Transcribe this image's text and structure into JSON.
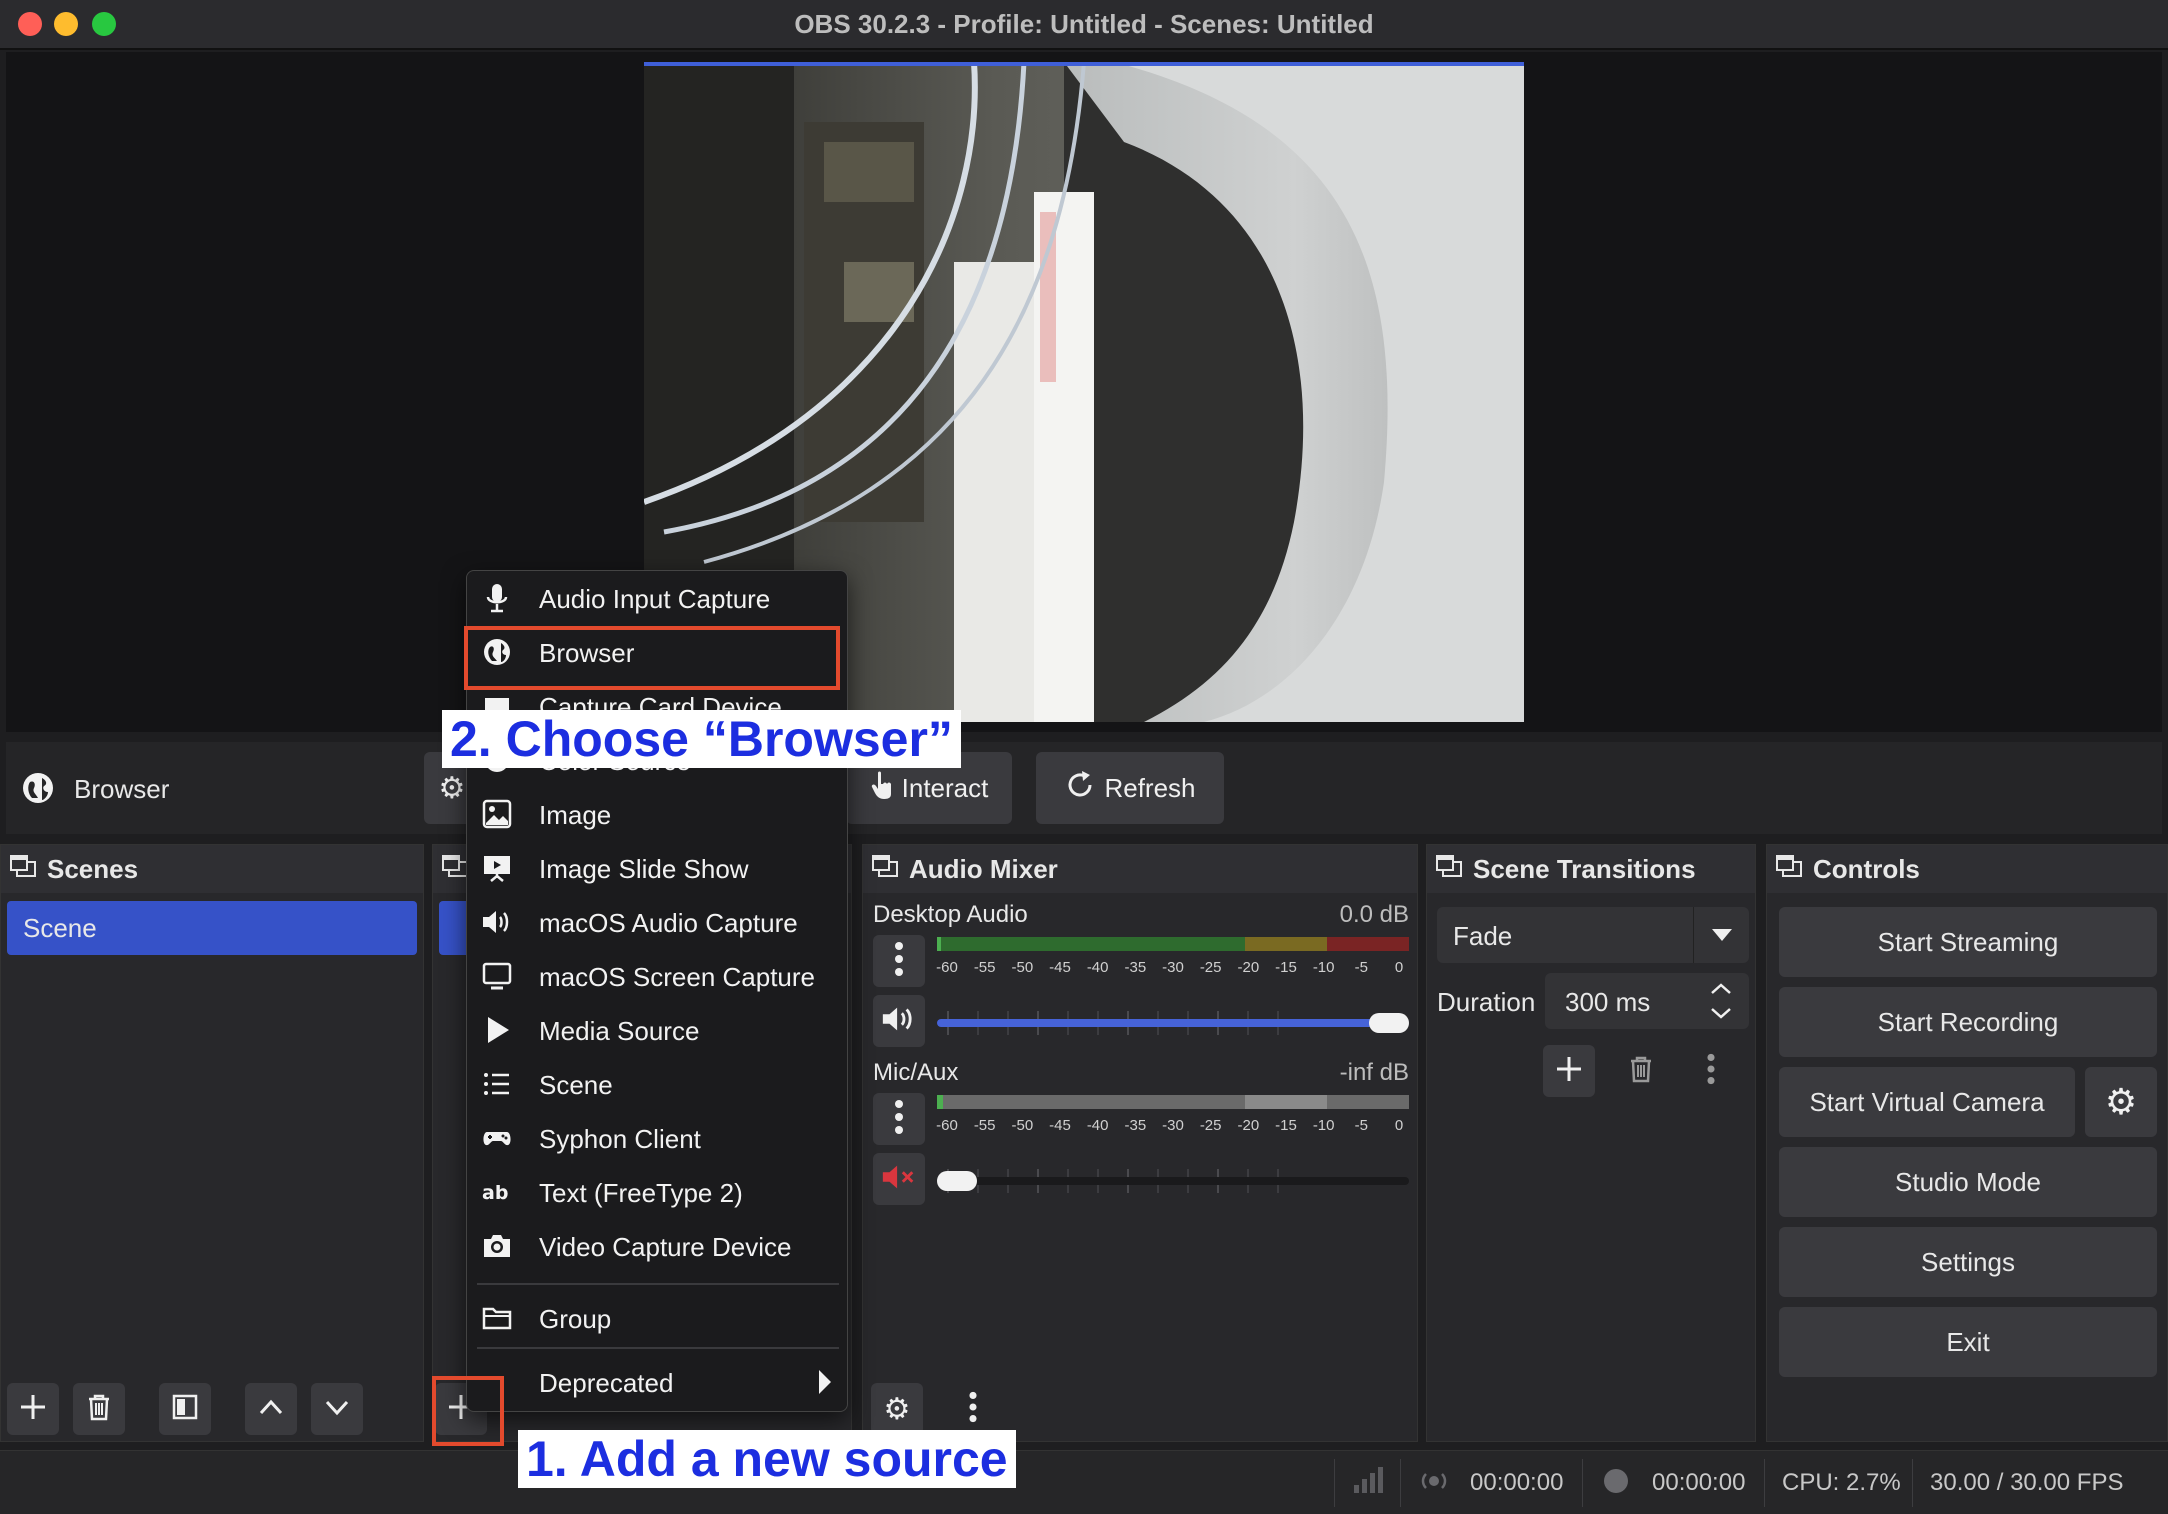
{
  "window": {
    "title": "OBS 30.2.3 - Profile: Untitled - Scenes: Untitled"
  },
  "source_toolbar": {
    "source_name": "Browser",
    "interact_label": "Interact",
    "refresh_label": "Refresh"
  },
  "scenes": {
    "title": "Scenes",
    "items": [
      {
        "label": "Scene",
        "selected": true
      }
    ]
  },
  "audio_mixer": {
    "title": "Audio Mixer",
    "scale": [
      "-60",
      "-55",
      "-50",
      "-45",
      "-40",
      "-35",
      "-30",
      "-25",
      "-20",
      "-15",
      "-10",
      "-5",
      "0"
    ],
    "channels": [
      {
        "name": "Desktop Audio",
        "level": "0.0 dB",
        "volume_fraction": 1.0,
        "muted": false
      },
      {
        "name": "Mic/Aux",
        "level": "-inf dB",
        "volume_fraction": 0.0,
        "muted": true
      }
    ]
  },
  "scene_transitions": {
    "title": "Scene Transitions",
    "transition": "Fade",
    "duration_label": "Duration",
    "duration_value": "300 ms"
  },
  "controls": {
    "title": "Controls",
    "start_streaming": "Start Streaming",
    "start_recording": "Start Recording",
    "start_virtual_camera": "Start Virtual Camera",
    "studio_mode": "Studio Mode",
    "settings": "Settings",
    "exit": "Exit"
  },
  "status_bar": {
    "stream_time": "00:00:00",
    "record_time": "00:00:00",
    "cpu": "CPU: 2.7%",
    "fps": "30.00 / 30.00 FPS"
  },
  "context_menu": {
    "items": [
      {
        "label": "Audio Input Capture",
        "icon": "microphone-icon"
      },
      {
        "label": "Browser",
        "icon": "globe-icon"
      },
      {
        "label": "Capture Card Device",
        "icon": "capture-card-icon"
      },
      {
        "label": "Color Source",
        "icon": "color-source-icon"
      },
      {
        "label": "Image",
        "icon": "image-icon"
      },
      {
        "label": "Image Slide Show",
        "icon": "slideshow-icon"
      },
      {
        "label": "macOS Audio Capture",
        "icon": "speaker-icon"
      },
      {
        "label": "macOS Screen Capture",
        "icon": "monitor-icon"
      },
      {
        "label": "Media Source",
        "icon": "play-icon"
      },
      {
        "label": "Scene",
        "icon": "list-icon"
      },
      {
        "label": "Syphon Client",
        "icon": "gamepad-icon"
      },
      {
        "label": "Text (FreeType 2)",
        "icon": "text-icon"
      },
      {
        "label": "Video Capture Device",
        "icon": "camera-icon"
      }
    ],
    "group": {
      "label": "Group",
      "icon": "folder-icon"
    },
    "deprecated": {
      "label": "Deprecated",
      "icon": "submenu-arrow-icon"
    }
  },
  "annotations": {
    "step_2": "2. Choose “Browser”",
    "step_1": "1. Add a new source"
  },
  "colors": {
    "accent": "#3652c8",
    "highlight_box": "#e34a2d",
    "annotation_text": "#1c2ee0",
    "meter_green": "#4caf50",
    "meter_yellow": "#c9a227",
    "meter_red": "#c0392b",
    "mute_red": "#d9363e"
  }
}
